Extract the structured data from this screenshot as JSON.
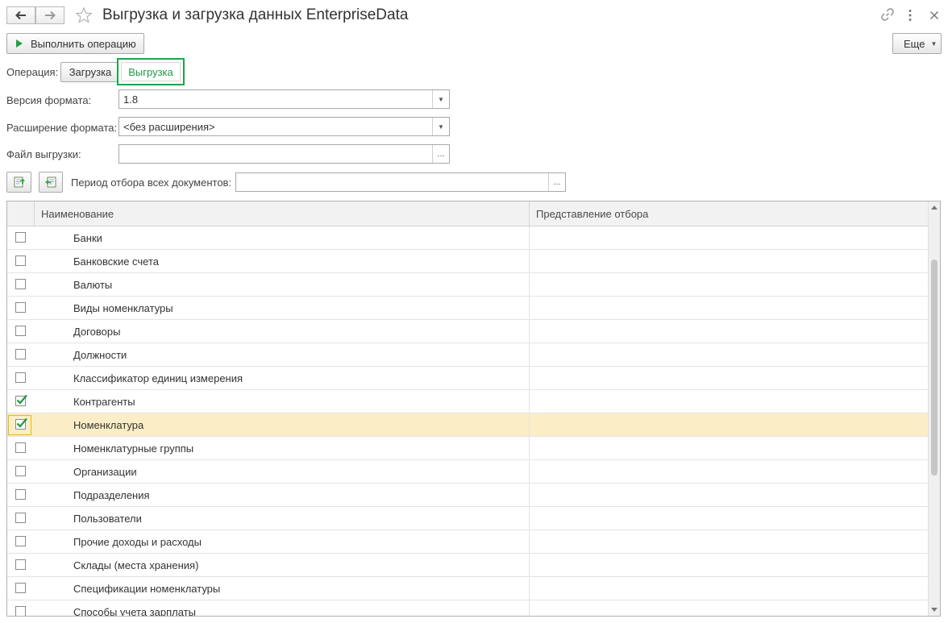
{
  "window": {
    "title": "Выгрузка и загрузка данных EnterpriseData"
  },
  "toolbar": {
    "run_label": "Выполнить операцию",
    "more_label": "Еще"
  },
  "operation": {
    "label": "Операция:",
    "options": [
      "Загрузка",
      "Выгрузка"
    ],
    "selected": "Выгрузка"
  },
  "format_version": {
    "label": "Версия формата:",
    "value": "1.8"
  },
  "format_extension": {
    "label": "Расширение формата:",
    "value": "<без расширения>"
  },
  "export_file": {
    "label": "Файл выгрузки:",
    "value": "",
    "button": "..."
  },
  "period": {
    "label": "Период отбора всех документов:",
    "value": "",
    "button": "..."
  },
  "table": {
    "columns": [
      "Наименование",
      "Представление отбора"
    ],
    "rows": [
      {
        "name": "Банки",
        "checked": false,
        "filter": ""
      },
      {
        "name": "Банковские счета",
        "checked": false,
        "filter": ""
      },
      {
        "name": "Валюты",
        "checked": false,
        "filter": ""
      },
      {
        "name": "Виды номенклатуры",
        "checked": false,
        "filter": ""
      },
      {
        "name": "Договоры",
        "checked": false,
        "filter": ""
      },
      {
        "name": "Должности",
        "checked": false,
        "filter": ""
      },
      {
        "name": "Классификатор единиц измерения",
        "checked": false,
        "filter": ""
      },
      {
        "name": "Контрагенты",
        "checked": true,
        "filter": ""
      },
      {
        "name": "Номенклатура",
        "checked": true,
        "filter": "",
        "selected": true
      },
      {
        "name": "Номенклатурные группы",
        "checked": false,
        "filter": ""
      },
      {
        "name": "Организации",
        "checked": false,
        "filter": ""
      },
      {
        "name": "Подразделения",
        "checked": false,
        "filter": ""
      },
      {
        "name": "Пользователи",
        "checked": false,
        "filter": ""
      },
      {
        "name": "Прочие доходы и расходы",
        "checked": false,
        "filter": ""
      },
      {
        "name": "Склады (места хранения)",
        "checked": false,
        "filter": ""
      },
      {
        "name": "Спецификации номенклатуры",
        "checked": false,
        "filter": ""
      },
      {
        "name": "Способы учета зарплаты",
        "checked": false,
        "filter": ""
      }
    ]
  },
  "colors": {
    "accent_green": "#1aa64a",
    "selected_row": "#fbeec6",
    "check_green": "#1d9a3c"
  }
}
